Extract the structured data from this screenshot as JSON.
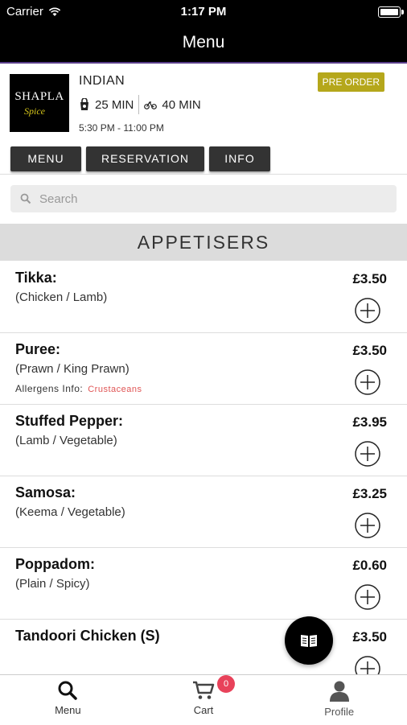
{
  "status_bar": {
    "carrier": "Carrier",
    "time": "1:17 PM"
  },
  "nav": {
    "title": "Menu"
  },
  "restaurant": {
    "logo_line1": "SHAPLA",
    "logo_line2": "Spice",
    "cuisine": "INDIAN",
    "collection_time": "25 MIN",
    "delivery_time": "40 MIN",
    "hours": "5:30 PM - 11:00 PM",
    "pre_order": "PRE ORDER"
  },
  "tabs": [
    {
      "label": "MENU"
    },
    {
      "label": "RESERVATION"
    },
    {
      "label": "INFO"
    }
  ],
  "search": {
    "placeholder": "Search"
  },
  "section": {
    "title": "APPETISERS"
  },
  "items": [
    {
      "name": "Tikka:",
      "desc": "(Chicken / Lamb)",
      "price": "£3.50"
    },
    {
      "name": "Puree:",
      "desc": "(Prawn / King Prawn)",
      "price": "£3.50",
      "allergens_label": "Allergens Info:",
      "allergens": "Crustaceans"
    },
    {
      "name": "Stuffed Pepper:",
      "desc": "(Lamb / Vegetable)",
      "price": "£3.95"
    },
    {
      "name": "Samosa:",
      "desc": "(Keema / Vegetable)",
      "price": "£3.25"
    },
    {
      "name": "Poppadom:",
      "desc": "(Plain / Spicy)",
      "price": "£0.60"
    },
    {
      "name": "Tandoori Chicken (S)",
      "desc": "",
      "price": "£3.50"
    }
  ],
  "tab_bar": {
    "menu": "Menu",
    "cart": "Cart",
    "cart_count": "0",
    "profile": "Profile"
  },
  "colors": {
    "pre_order_bg": "#b5a71b",
    "allergen_tag": "#e05555",
    "cart_badge": "#e8425a",
    "nav_accent": "#5a3e8a"
  }
}
